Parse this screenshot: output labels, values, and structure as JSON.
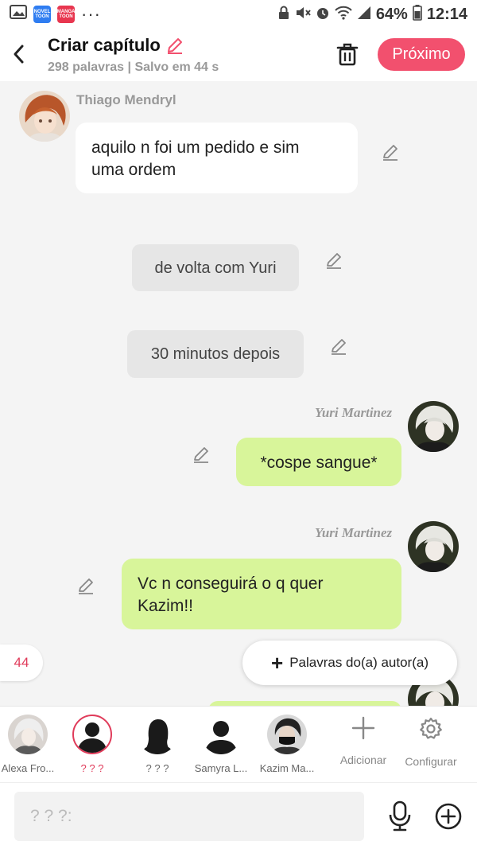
{
  "status_bar": {
    "app_badges": [
      "NOVEL TOON",
      "MANGA TOON"
    ],
    "more": "···",
    "battery": "64%",
    "time": "12:14"
  },
  "header": {
    "title": "Criar capítulo",
    "subtitle": "298 palavras | Salvo em 44 s",
    "next_label": "Próximo"
  },
  "messages": [
    {
      "type": "left",
      "name": "Thiago Mendryl",
      "text": "aquilo n foi um pedido e sim\numa ordem"
    },
    {
      "type": "narration",
      "text": "de volta com Yuri"
    },
    {
      "type": "narration",
      "text": "30 minutos depois"
    },
    {
      "type": "right",
      "name": "Yuri Martinez",
      "text": "*cospe sangue*"
    },
    {
      "type": "right",
      "name": "Yuri Martinez",
      "text": "Vc n conseguirá o q quer\nKazim!!"
    }
  ],
  "word_count_badge": "44",
  "author_words_label": "Palavras do(a) autor(a)",
  "characters": [
    {
      "label": "Alexa Fro..."
    },
    {
      "label": "? ? ?",
      "selected": true
    },
    {
      "label": "? ? ?"
    },
    {
      "label": "Samyra L..."
    },
    {
      "label": "Kazim Ma..."
    }
  ],
  "tools": {
    "add_label": "Adicionar",
    "settings_label": "Configurar"
  },
  "input": {
    "placeholder": "? ? ?:"
  },
  "colors": {
    "accent": "#f2506e",
    "bubble_green": "#d8f59a",
    "bubble_white": "#ffffff",
    "narration_gray": "#e6e6e6"
  }
}
